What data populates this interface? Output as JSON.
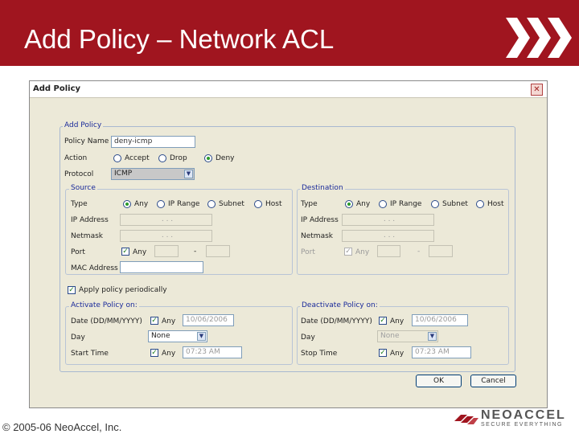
{
  "slide": {
    "title": "Add Policy – Network ACL",
    "footer": "© 2005-06 NeoAccel, Inc.",
    "brand_name": "NEOACCEL",
    "brand_tagline": "SECURE EVERYTHING",
    "header_color": "#a0151f"
  },
  "dialog": {
    "title": "Add Policy",
    "close_glyph": "✕",
    "group_title": "Add Policy",
    "policy_name_label": "Policy Name",
    "policy_name_value": "deny-icmp",
    "action_label": "Action",
    "action_options": [
      "Accept",
      "Drop",
      "Deny"
    ],
    "action_selected": "Deny",
    "protocol_label": "Protocol",
    "protocol_value": "ICMP",
    "apply_periodically_label": "Apply policy periodically",
    "ok_label": "OK",
    "cancel_label": "Cancel"
  },
  "source": {
    "title": "Source",
    "type_label": "Type",
    "type_options": [
      "Any",
      "IP Range",
      "Subnet",
      "Host"
    ],
    "type_selected": "Any",
    "ip_label": "IP Address",
    "netmask_label": "Netmask",
    "port_label": "Port",
    "port_any_label": "Any",
    "port_dash": "-",
    "mac_label": "MAC Address",
    "ip_dots": ".   .   ."
  },
  "destination": {
    "title": "Destination",
    "type_label": "Type",
    "type_options": [
      "Any",
      "IP Range",
      "Subnet",
      "Host"
    ],
    "type_selected": "Any",
    "ip_label": "IP Address",
    "netmask_label": "Netmask",
    "port_label": "Port",
    "port_any_label": "Any",
    "port_dash": "-",
    "ip_dots": ".   .   ."
  },
  "activate": {
    "title": "Activate Policy on:",
    "date_label": "Date (DD/MM/YYYY)",
    "date_any": "Any",
    "date_value": "10/06/2006",
    "day_label": "Day",
    "day_value": "None",
    "start_label": "Start Time",
    "start_any": "Any",
    "start_value": "07:23 AM"
  },
  "deactivate": {
    "title": "Deactivate Policy on:",
    "date_label": "Date (DD/MM/YYYY)",
    "date_any": "Any",
    "date_value": "10/06/2006",
    "day_label": "Day",
    "day_value": "None",
    "stop_label": "Stop Time",
    "stop_any": "Any",
    "stop_value": "07:23 AM"
  }
}
